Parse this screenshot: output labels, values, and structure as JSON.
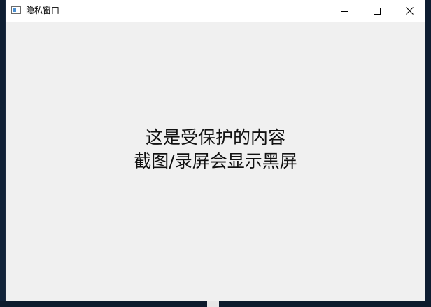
{
  "window": {
    "title": "隐私窗口",
    "icon": "window-app-icon"
  },
  "caption_buttons": {
    "minimize_icon": "minimize-icon",
    "maximize_icon": "maximize-icon",
    "close_icon": "close-icon"
  },
  "content": {
    "line1": "这是受保护的内容",
    "line2": "截图/录屏会显示黑屏"
  },
  "colors": {
    "titlebar_bg": "#ffffff",
    "client_bg": "#f0f0f0",
    "desktop_bg": "#0f1f33",
    "text": "#111111"
  }
}
